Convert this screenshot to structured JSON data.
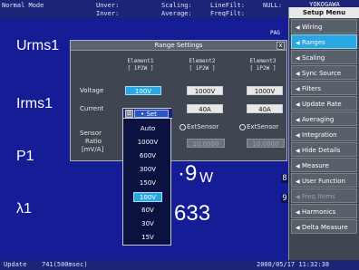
{
  "status": {
    "mode": "Normal Mode",
    "unver": "Unver:",
    "inver": "Inver:",
    "scaling": "Scaling:",
    "average": "Average:",
    "linefilt": "LineFilt:",
    "freqfilt": "FreqFilt:",
    "null": "NULL:",
    "brand": "YOKOGAWA"
  },
  "display": {
    "labels": [
      "Urms1",
      "Irms1",
      "P1",
      "λ1"
    ],
    "p1_value": "·9",
    "p1_unit": "W",
    "lambda_value": "633",
    "page": "PAG",
    "edge_digits": [
      "8",
      "9"
    ]
  },
  "menu": {
    "title": "Setup Menu",
    "items": [
      {
        "label": "Wiring",
        "state": "normal"
      },
      {
        "label": "Ranges",
        "state": "selected"
      },
      {
        "label": "Scaling",
        "state": "normal"
      },
      {
        "label": "Sync Source",
        "state": "normal"
      },
      {
        "label": "Filters",
        "state": "normal"
      },
      {
        "label": "Update Rate",
        "state": "normal"
      },
      {
        "label": "Averaging",
        "state": "normal"
      },
      {
        "label": "Integration",
        "state": "normal"
      },
      {
        "label": "Hide Details",
        "state": "normal"
      },
      {
        "label": "Measure",
        "state": "normal"
      },
      {
        "label": "User Function",
        "state": "normal"
      },
      {
        "label": "Freq Items",
        "state": "dim"
      },
      {
        "label": "Harmonics",
        "state": "normal"
      },
      {
        "label": "Delta Measure",
        "state": "normal"
      }
    ]
  },
  "dialog": {
    "title": "Range Settings",
    "close": "x",
    "elements": [
      {
        "name": "Element1",
        "wiring": "[ 1P2W ]",
        "voltage": "100V",
        "current": "",
        "sensor": "ExtSensor",
        "ratio": "10.0000"
      },
      {
        "name": "Element2",
        "wiring": "[ 1P2W ]",
        "voltage": "1000V",
        "current": "40A",
        "sensor": "ExtSensor",
        "ratio": "10.0000"
      },
      {
        "name": "Element3",
        "wiring": "[ 1P2W ]",
        "voltage": "1000V",
        "current": "40A",
        "sensor": "ExtSensor",
        "ratio": "10.0000"
      }
    ],
    "row_labels": {
      "voltage": "Voltage",
      "current": "Current",
      "sensor_ratio": [
        "Sensor",
        "Ratio",
        "[mV/A]"
      ]
    }
  },
  "dropdown": {
    "set_label": "Set",
    "options": [
      "Auto",
      "1000V",
      "600V",
      "300V",
      "150V",
      "100V",
      "60V",
      "30V",
      "15V"
    ],
    "selected": "100V"
  },
  "footer": {
    "update": "Update",
    "count": "741(500msec)",
    "datetime": "2008/05/17  11:32:38"
  }
}
